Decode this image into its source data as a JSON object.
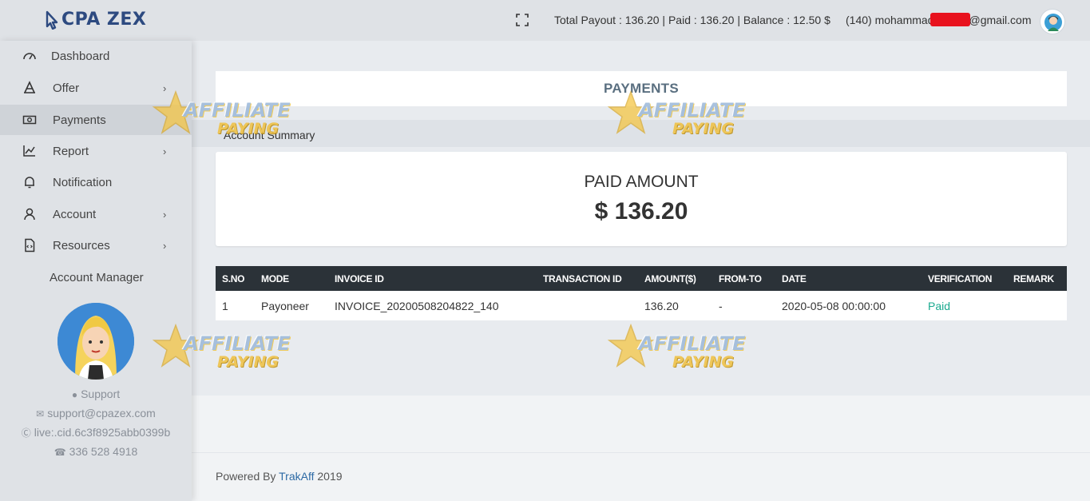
{
  "brand": {
    "name": "CPA ZEX"
  },
  "header": {
    "summary": "Total Payout : 136.20 | Paid : 136.20 | Balance : 12.50 $",
    "user_email_prefix": "(140) mohammad",
    "user_email_suffix": "@gmail.com"
  },
  "sidebar": {
    "items": [
      {
        "label": "Dashboard",
        "icon": "dashboard-gauge-icon",
        "has_submenu": false
      },
      {
        "label": "Offer",
        "icon": "offer-icon",
        "has_submenu": true
      },
      {
        "label": "Payments",
        "icon": "money-icon",
        "has_submenu": false,
        "active": true
      },
      {
        "label": "Report",
        "icon": "chart-icon",
        "has_submenu": true
      },
      {
        "label": "Notification",
        "icon": "bell-icon",
        "has_submenu": false
      },
      {
        "label": "Account",
        "icon": "user-icon",
        "has_submenu": true
      },
      {
        "label": "Resources",
        "icon": "file-code-icon",
        "has_submenu": true
      },
      {
        "label": "Account Manager",
        "icon": "",
        "has_submenu": false
      }
    ],
    "chevron": "›",
    "manager": {
      "support_label": "Support",
      "email": "support@cpazex.com",
      "skype": "live:.cid.6c3f8925abb0399b",
      "phone": "336 528 4918"
    }
  },
  "page": {
    "title": "PAYMENTS",
    "section": "Account Summary",
    "paid_amount_label": "PAID AMOUNT",
    "paid_amount_value": "$ 136.20"
  },
  "table": {
    "columns": [
      "S.NO",
      "MODE",
      "INVOICE ID",
      "TRANSACTION ID",
      "AMOUNT($)",
      "FROM-TO",
      "DATE",
      "VERIFICATION",
      "REMARK"
    ],
    "rows": [
      [
        "1",
        "Payoneer",
        "INVOICE_20200508204822_140",
        "",
        "136.20",
        "-",
        "2020-05-08 00:00:00",
        "Paid",
        ""
      ]
    ]
  },
  "footer": {
    "prefix": "Powered By ",
    "link": "TrakAff",
    "suffix": " 2019"
  },
  "watermark": {
    "line1": "AFFILIATE",
    "line2": "PAYING"
  },
  "colors": {
    "brand": "#2d4a80",
    "paid_status": "#1aaa8f",
    "table_header": "#2b3238",
    "link": "#2d6aa5"
  }
}
